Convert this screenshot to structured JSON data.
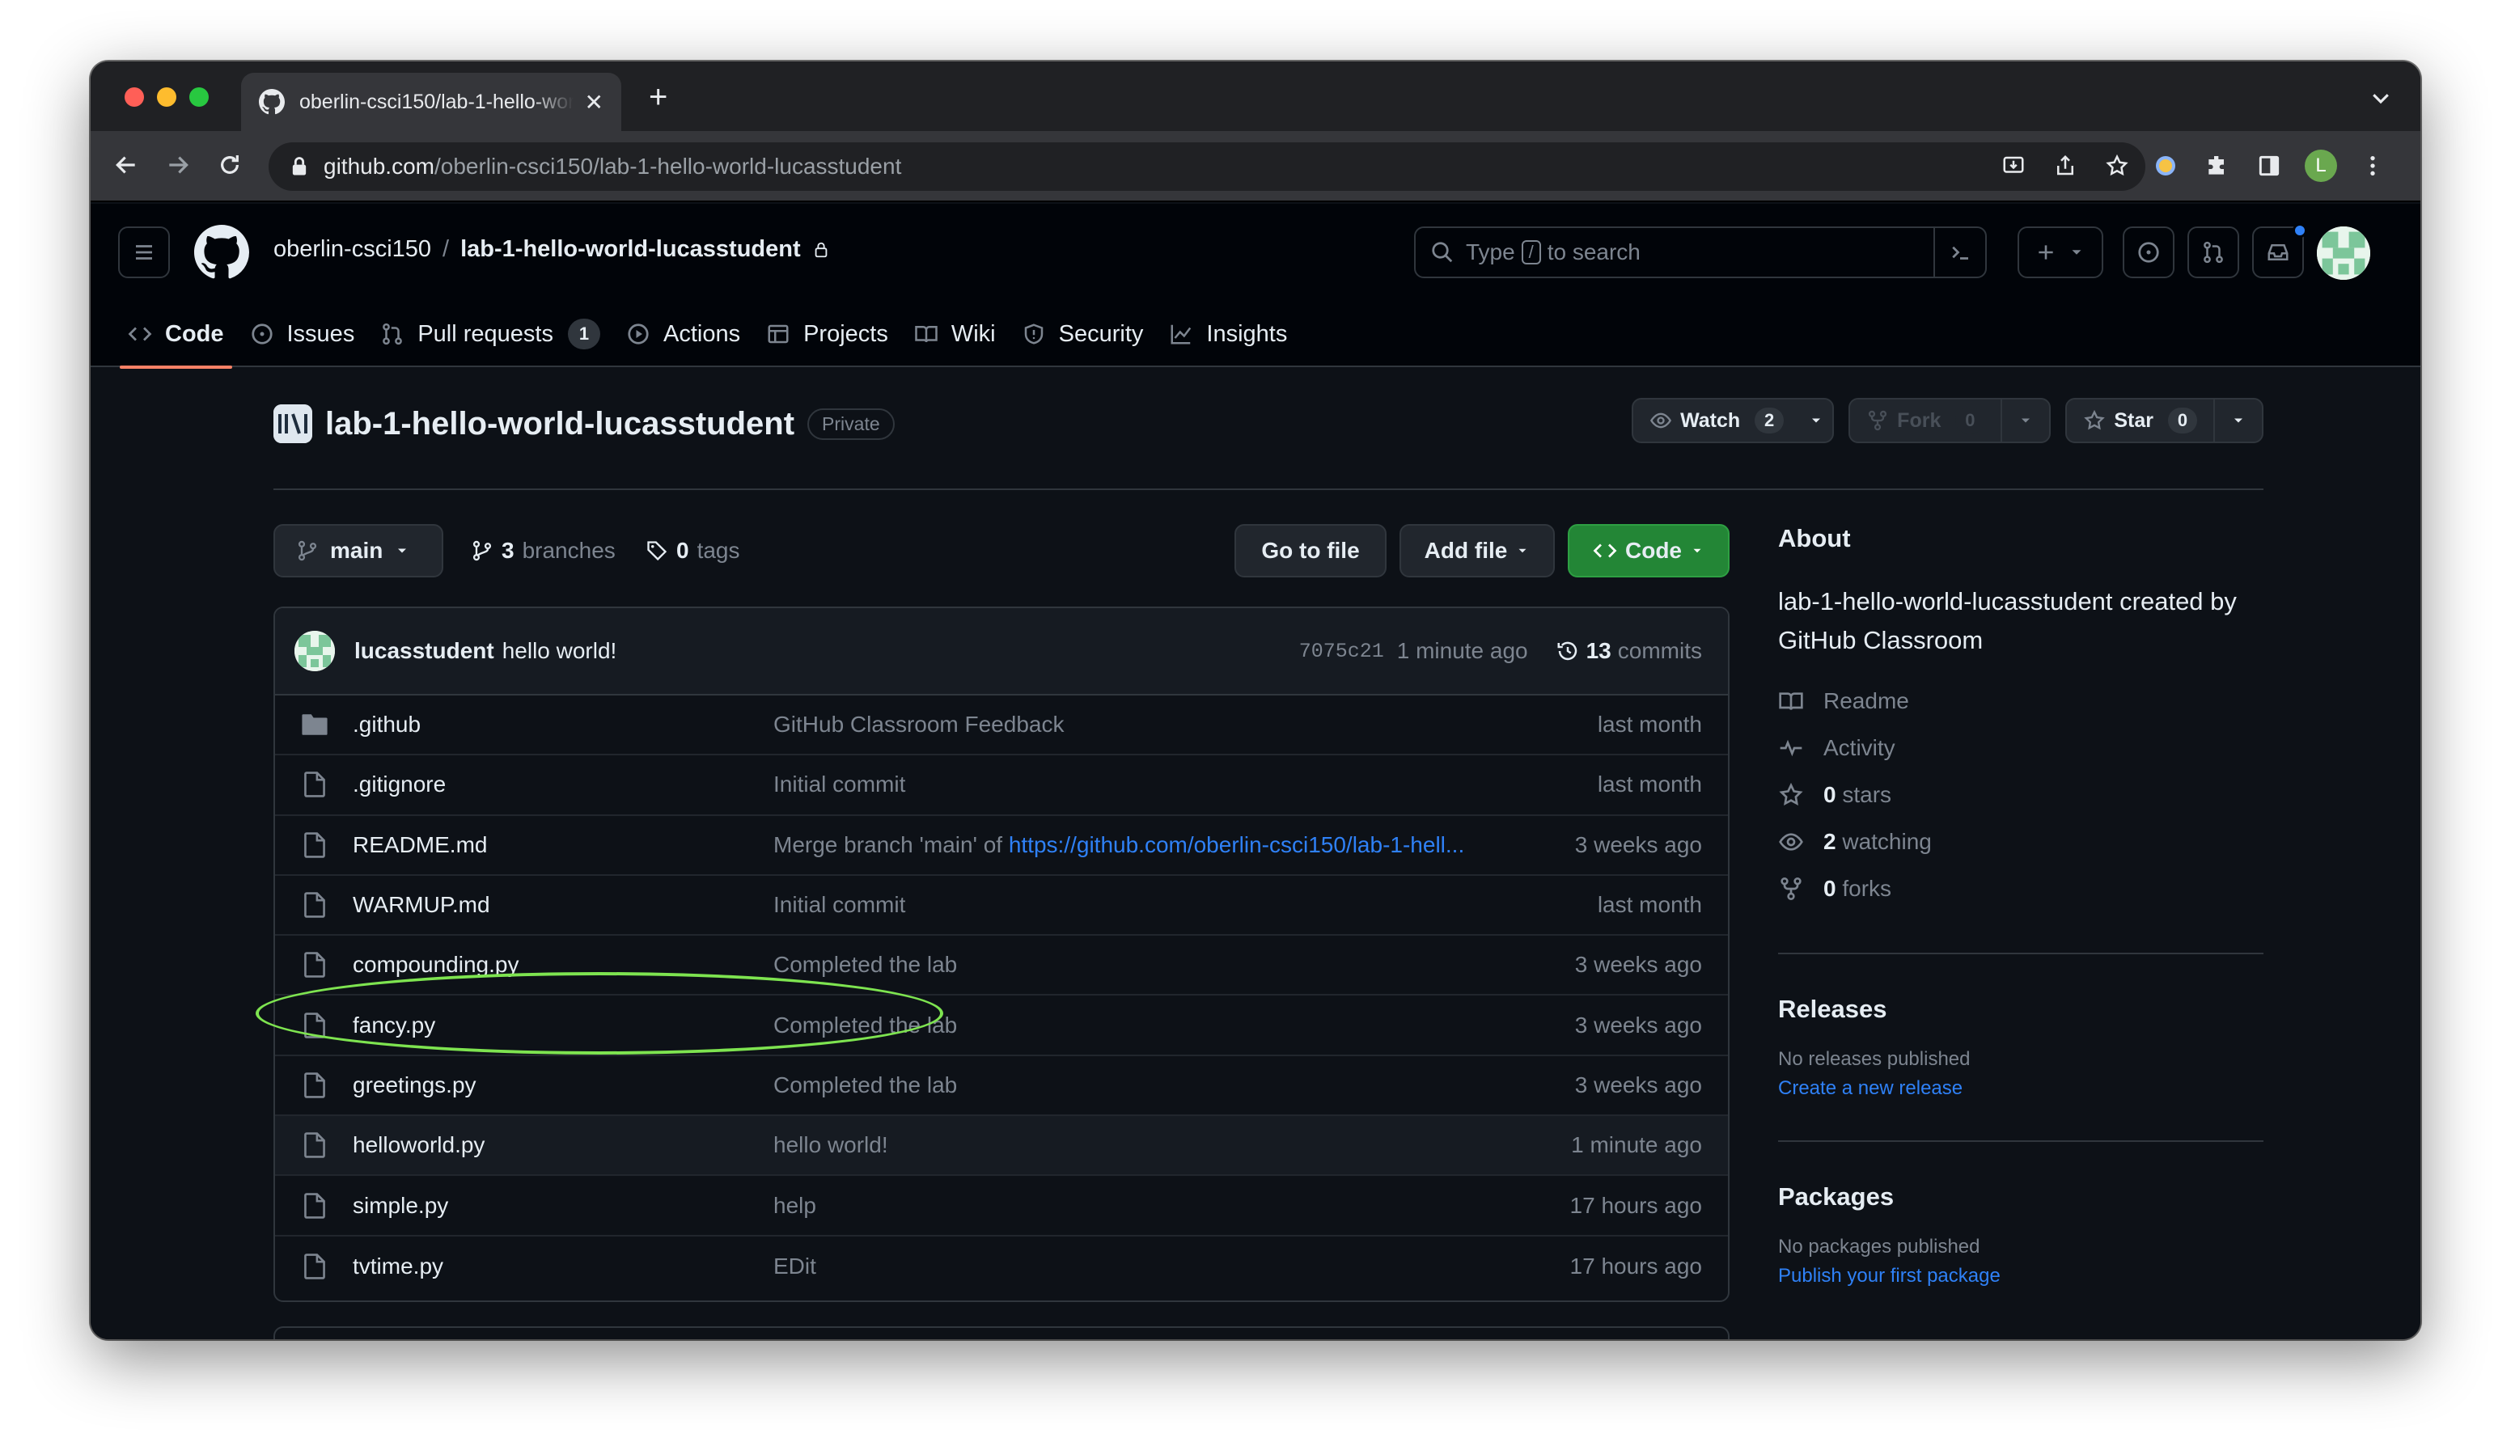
{
  "browser": {
    "tab_title": "oberlin-csci150/lab-1-hello-world-lucasstudent",
    "url_host": "github.com",
    "url_path": "/oberlin-csci150/lab-1-hello-world-lucasstudent",
    "profile_initial": "L"
  },
  "header": {
    "org": "oberlin-csci150",
    "separator": "/",
    "repo": "lab-1-hello-world-lucasstudent",
    "search_prefix": "Type",
    "search_key": "/",
    "search_suffix": "to search"
  },
  "repo_nav": [
    {
      "label": "Code",
      "icon": "code-icon"
    },
    {
      "label": "Issues",
      "icon": "issue-icon"
    },
    {
      "label": "Pull requests",
      "icon": "pull-request-icon",
      "count": "1"
    },
    {
      "label": "Actions",
      "icon": "play-icon"
    },
    {
      "label": "Projects",
      "icon": "table-icon"
    },
    {
      "label": "Wiki",
      "icon": "book-icon"
    },
    {
      "label": "Security",
      "icon": "shield-icon"
    },
    {
      "label": "Insights",
      "icon": "graph-icon"
    }
  ],
  "repo": {
    "name": "lab-1-hello-world-lucasstudent",
    "visibility": "Private",
    "watch_label": "Watch",
    "watch_count": "2",
    "fork_label": "Fork",
    "fork_count": "0",
    "star_label": "Star",
    "star_count": "0"
  },
  "filenav": {
    "branch": "main",
    "branches_count": "3",
    "branches_label": "branches",
    "tags_count": "0",
    "tags_label": "tags",
    "go_to_file": "Go to file",
    "add_file": "Add file",
    "code": "Code"
  },
  "latest_commit": {
    "author": "lucasstudent",
    "message": "hello world!",
    "sha": "7075c21",
    "age": "1 minute ago",
    "commits_count": "13",
    "commits_label": "commits"
  },
  "files": [
    {
      "name": ".github",
      "type": "dir",
      "message": "GitHub Classroom Feedback",
      "age": "last month"
    },
    {
      "name": ".gitignore",
      "type": "file",
      "message": "Initial commit",
      "age": "last month"
    },
    {
      "name": "README.md",
      "type": "file",
      "message": "Merge branch 'main' of ",
      "link": "https://github.com/oberlin-csci150/lab-1-hell...",
      "age": "3 weeks ago"
    },
    {
      "name": "WARMUP.md",
      "type": "file",
      "message": "Initial commit",
      "age": "last month"
    },
    {
      "name": "compounding.py",
      "type": "file",
      "message": "Completed the lab",
      "age": "3 weeks ago"
    },
    {
      "name": "fancy.py",
      "type": "file",
      "message": "Completed the lab",
      "age": "3 weeks ago"
    },
    {
      "name": "greetings.py",
      "type": "file",
      "message": "Completed the lab",
      "age": "3 weeks ago"
    },
    {
      "name": "helloworld.py",
      "type": "file",
      "message": "hello world!",
      "age": "1 minute ago"
    },
    {
      "name": "simple.py",
      "type": "file",
      "message": "help",
      "age": "17 hours ago"
    },
    {
      "name": "tvtime.py",
      "type": "file",
      "message": "EDit",
      "age": "17 hours ago"
    }
  ],
  "about": {
    "title": "About",
    "description": "lab-1-hello-world-lucasstudent created by GitHub Classroom",
    "readme": "Readme",
    "activity": "Activity",
    "stars_count": "0",
    "stars_label": "stars",
    "watching_count": "2",
    "watching_label": "watching",
    "forks_count": "0",
    "forks_label": "forks"
  },
  "releases": {
    "title": "Releases",
    "empty": "No releases published",
    "link": "Create a new release"
  },
  "packages": {
    "title": "Packages",
    "empty": "No packages published",
    "link": "Publish your first package"
  },
  "colors": {
    "accent_green": "#238636",
    "link_blue": "#2f81f7",
    "highlight_circle": "#7ee450",
    "tab_underline": "#f78166"
  }
}
